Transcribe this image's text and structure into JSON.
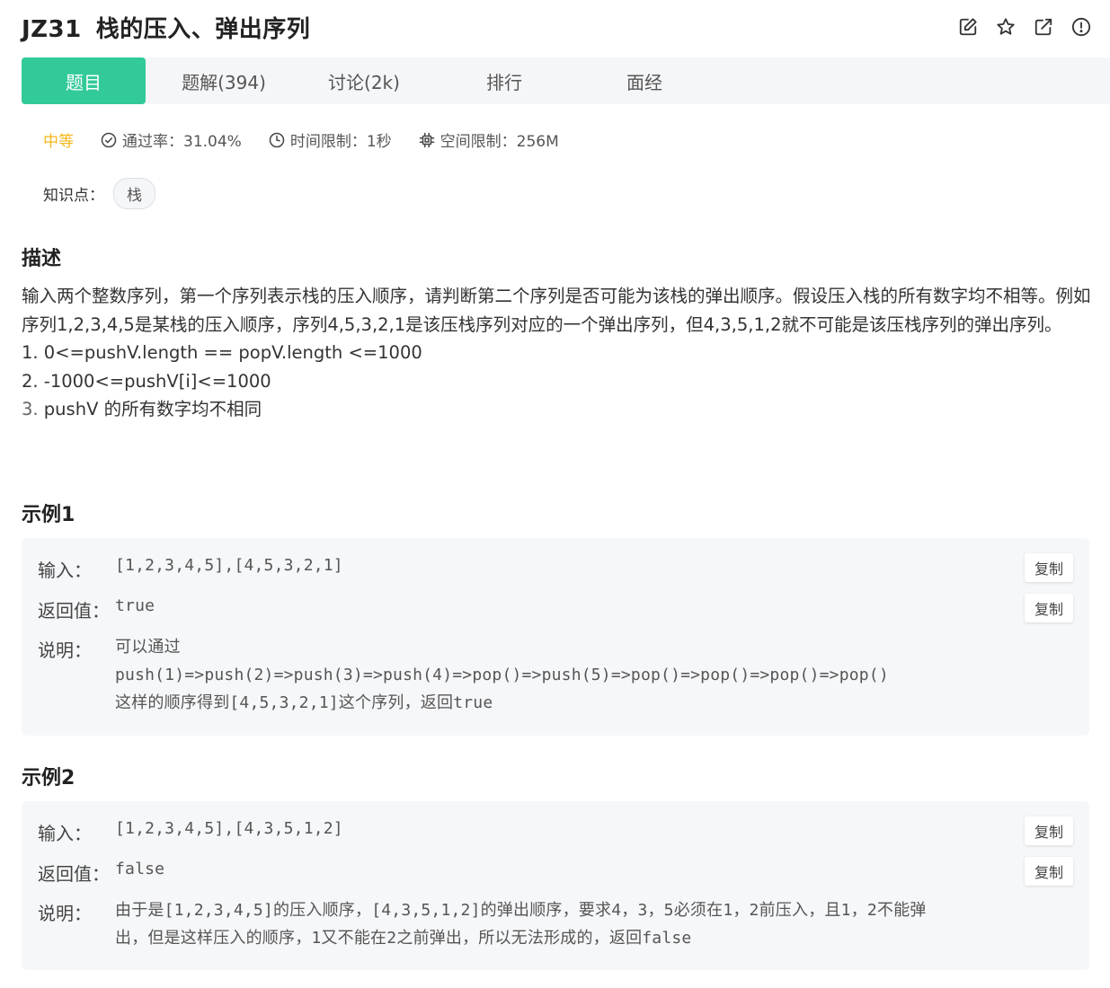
{
  "header": {
    "code": "JZ31",
    "title": "栈的压入、弹出序列",
    "icons": [
      "edit-icon",
      "star-icon",
      "share-icon",
      "info-icon"
    ]
  },
  "tabs": [
    {
      "label": "题目",
      "active": true
    },
    {
      "label": "题解(394)",
      "active": false
    },
    {
      "label": "讨论(2k)",
      "active": false
    },
    {
      "label": "排行",
      "active": false
    },
    {
      "label": "面经",
      "active": false
    }
  ],
  "meta": {
    "difficulty": "中等",
    "pass_rate": "通过率：31.04%",
    "time_limit": "时间限制：1秒",
    "space_limit": "空间限制：256M"
  },
  "knowledge": {
    "label": "知识点：",
    "tag": "栈"
  },
  "description": {
    "title": "描述",
    "paragraph": "输入两个整数序列，第一个序列表示栈的压入顺序，请判断第二个序列是否可能为该栈的弹出顺序。假设压入栈的所有数字均不相等。例如序列1,2,3,4,5是某栈的压入顺序，序列4,5,3,2,1是该压栈序列对应的一个弹出序列，但4,3,5,1,2就不可能是该压栈序列的弹出序列。",
    "constraint1": "1. 0<=pushV.length == popV.length <=1000",
    "constraint2": "2. -1000<=pushV[i]<=1000",
    "constraint3_num": "3.",
    "constraint3_text": " pushV 的所有数字均不相同"
  },
  "example1": {
    "title": "示例1",
    "input_label": "输入：",
    "input_value": "[1,2,3,4,5],[4,5,3,2,1]",
    "return_label": "返回值：",
    "return_value": "true",
    "explain_label": "说明：",
    "explain_line1": "可以通过",
    "explain_line2": "push(1)=>push(2)=>push(3)=>push(4)=>pop()=>push(5)=>pop()=>pop()=>pop()=>pop()",
    "explain_line3": "这样的顺序得到[4,5,3,2,1]这个序列，返回true",
    "copy_label": "复制"
  },
  "example2": {
    "title": "示例2",
    "input_label": "输入：",
    "input_value": "[1,2,3,4,5],[4,3,5,1,2]",
    "return_label": "返回值：",
    "return_value": "false",
    "explain_label": "说明：",
    "explain_line1": "由于是[1,2,3,4,5]的压入顺序，[4,3,5,1,2]的弹出顺序，要求4，3，5必须在1，2前压入，且1，2不能弹",
    "explain_line2": "出，但是这样压入的顺序，1又不能在2之前弹出，所以无法形成的，返回false",
    "copy_label": "复制"
  },
  "colors": {
    "accent": "#32ca99",
    "difficulty": "#f4b718",
    "panel_bg": "#f6f7f9"
  }
}
